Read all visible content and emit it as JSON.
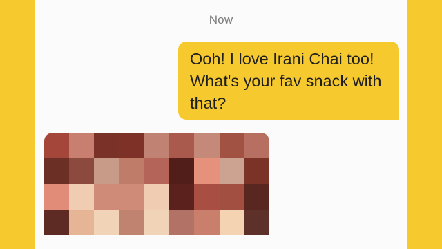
{
  "conversation": {
    "timestamp": "Now",
    "messages": [
      {
        "direction": "outgoing",
        "text": "Ooh! I love Irani Chai too! What's your fav snack with that?",
        "bubble_color": "#f6c92f"
      },
      {
        "direction": "incoming",
        "content_type": "pixelated-image",
        "mosaic_rows": [
          [
            "#a4473a",
            "#c87f6f",
            "#7a3127",
            "#7e3227",
            "#c08272",
            "#a95a4c",
            "#c5897a",
            "#a15243",
            "#b66f61"
          ],
          [
            "#6c2f26",
            "#8c4a3f",
            "#c89a88",
            "#bf7d69",
            "#b5645a",
            "#521e1a",
            "#e5917c",
            "#cca390",
            "#7a3326"
          ],
          [
            "#e08c78",
            "#f0ccb2",
            "#cf8a78",
            "#cf8a78",
            "#f0ccb2",
            "#5b221d",
            "#a94e43",
            "#a24e40",
            "#5a2620"
          ],
          [
            "#5e2b24",
            "#e6b596",
            "#f1d3b7",
            "#c08370",
            "#f1d3b7",
            "#b27265",
            "#ca7f6c",
            "#f4d3b3",
            "#5e302a"
          ]
        ]
      }
    ]
  },
  "theme": {
    "frame_color": "#f6c92f",
    "panel_color": "#fbfbfb",
    "timestamp_color": "#7b7b7b"
  }
}
